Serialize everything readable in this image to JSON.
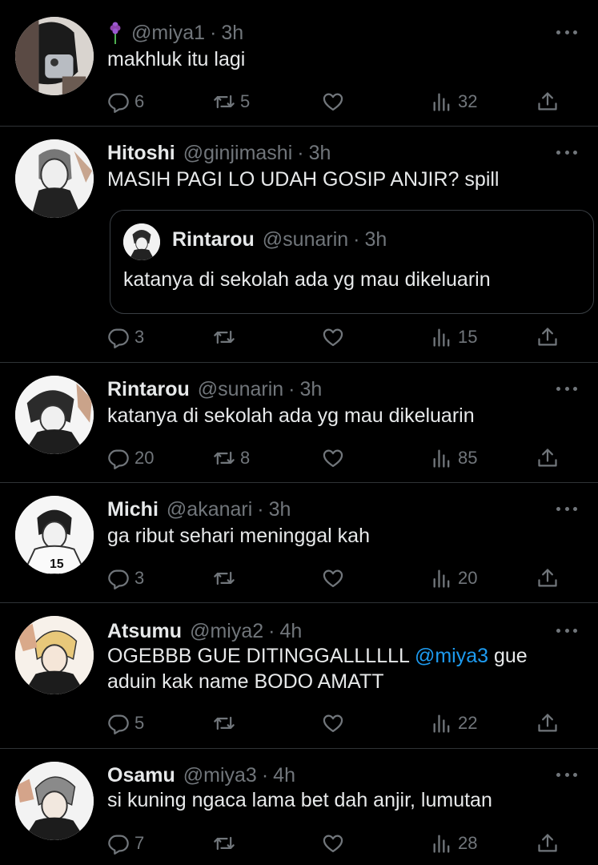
{
  "tweets": [
    {
      "name": "",
      "name_emoji": "purple-flower-emoji",
      "handle": "@miya1",
      "time": "3h",
      "text": "makhluk itu lagi",
      "replies": "6",
      "retweets": "5",
      "likes": "",
      "views": "32"
    },
    {
      "name": "Hitoshi",
      "handle": "@ginjimashi",
      "time": "3h",
      "text": "MASIH PAGI LO UDAH GOSIP ANJIR? spill",
      "quote": {
        "name": "Rintarou",
        "handle": "@sunarin",
        "time": "3h",
        "text": "katanya di sekolah ada yg mau dikeluarin"
      },
      "replies": "3",
      "retweets": "",
      "likes": "",
      "views": "15"
    },
    {
      "name": "Rintarou",
      "handle": "@sunarin",
      "time": "3h",
      "text": "katanya di sekolah ada yg mau dikeluarin",
      "replies": "20",
      "retweets": "8",
      "likes": "",
      "views": "85"
    },
    {
      "name": "Michi",
      "handle": "@akanari",
      "time": "3h",
      "text": "ga ribut sehari meninggal kah",
      "replies": "3",
      "retweets": "",
      "likes": "",
      "views": "20"
    },
    {
      "name": "Atsumu",
      "handle": "@miya2",
      "time": "4h",
      "text_line1_a": "OGEBBB GUE DITINGGALLLLLL ",
      "text_mention": "@miya3",
      "text_line1_b": " gue",
      "text_line2": "aduin kak name BODO AMATT",
      "replies": "5",
      "retweets": "",
      "likes": "",
      "views": "22"
    },
    {
      "name": "Osamu",
      "handle": "@miya3",
      "time": "4h",
      "text": "si kuning ngaca lama bet dah anjir, lumutan",
      "replies": "7",
      "retweets": "",
      "likes": "",
      "views": "28"
    }
  ],
  "separator": "·",
  "colors": {
    "background": "#000000",
    "text": "#e7e9ea",
    "muted": "#71767b",
    "mention": "#1d9bf0",
    "divider": "#2f3336"
  }
}
